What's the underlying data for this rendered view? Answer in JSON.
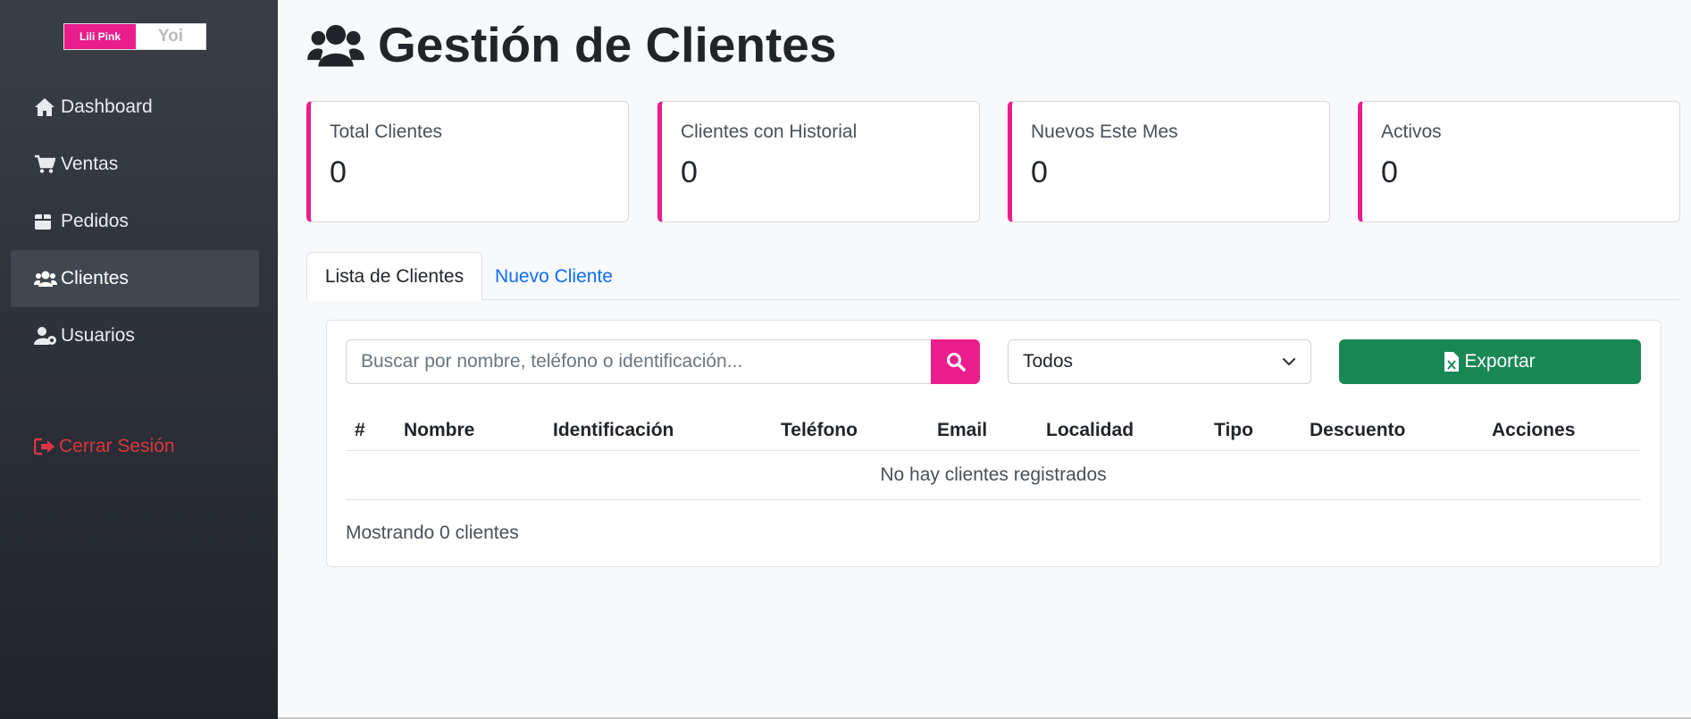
{
  "sidebar": {
    "logo": {
      "left_text": "Lili Pink",
      "right_text": "Yoi"
    },
    "items": [
      {
        "label": "Dashboard",
        "icon": "home-icon"
      },
      {
        "label": "Ventas",
        "icon": "cart-icon"
      },
      {
        "label": "Pedidos",
        "icon": "box-icon"
      },
      {
        "label": "Clientes",
        "icon": "users-icon",
        "active": true
      },
      {
        "label": "Usuarios",
        "icon": "user-gear-icon"
      }
    ],
    "logout_label": "Cerrar Sesión"
  },
  "header": {
    "title": "Gestión de Clientes",
    "icon": "users-icon"
  },
  "stats": [
    {
      "label": "Total Clientes",
      "value": "0"
    },
    {
      "label": "Clientes con Historial",
      "value": "0"
    },
    {
      "label": "Nuevos Este Mes",
      "value": "0"
    },
    {
      "label": "Activos",
      "value": "0"
    }
  ],
  "tabs": [
    {
      "label": "Lista de Clientes",
      "active": true
    },
    {
      "label": "Nuevo Cliente",
      "active": false
    }
  ],
  "filters": {
    "search_placeholder": "Buscar por nombre, teléfono o identificación...",
    "search_value": "",
    "type_selected": "Todos",
    "export_label": "Exportar"
  },
  "table": {
    "columns": [
      "#",
      "Nombre",
      "Identificación",
      "Teléfono",
      "Email",
      "Localidad",
      "Tipo",
      "Descuento",
      "Acciones"
    ],
    "empty_message": "No hay clientes registrados",
    "footer": "Mostrando 0 clientes"
  },
  "colors": {
    "accent": "#e91e8c",
    "sidebar": "#2b3036",
    "export": "#198754",
    "link": "#0d6efd",
    "danger": "#dc3545"
  }
}
